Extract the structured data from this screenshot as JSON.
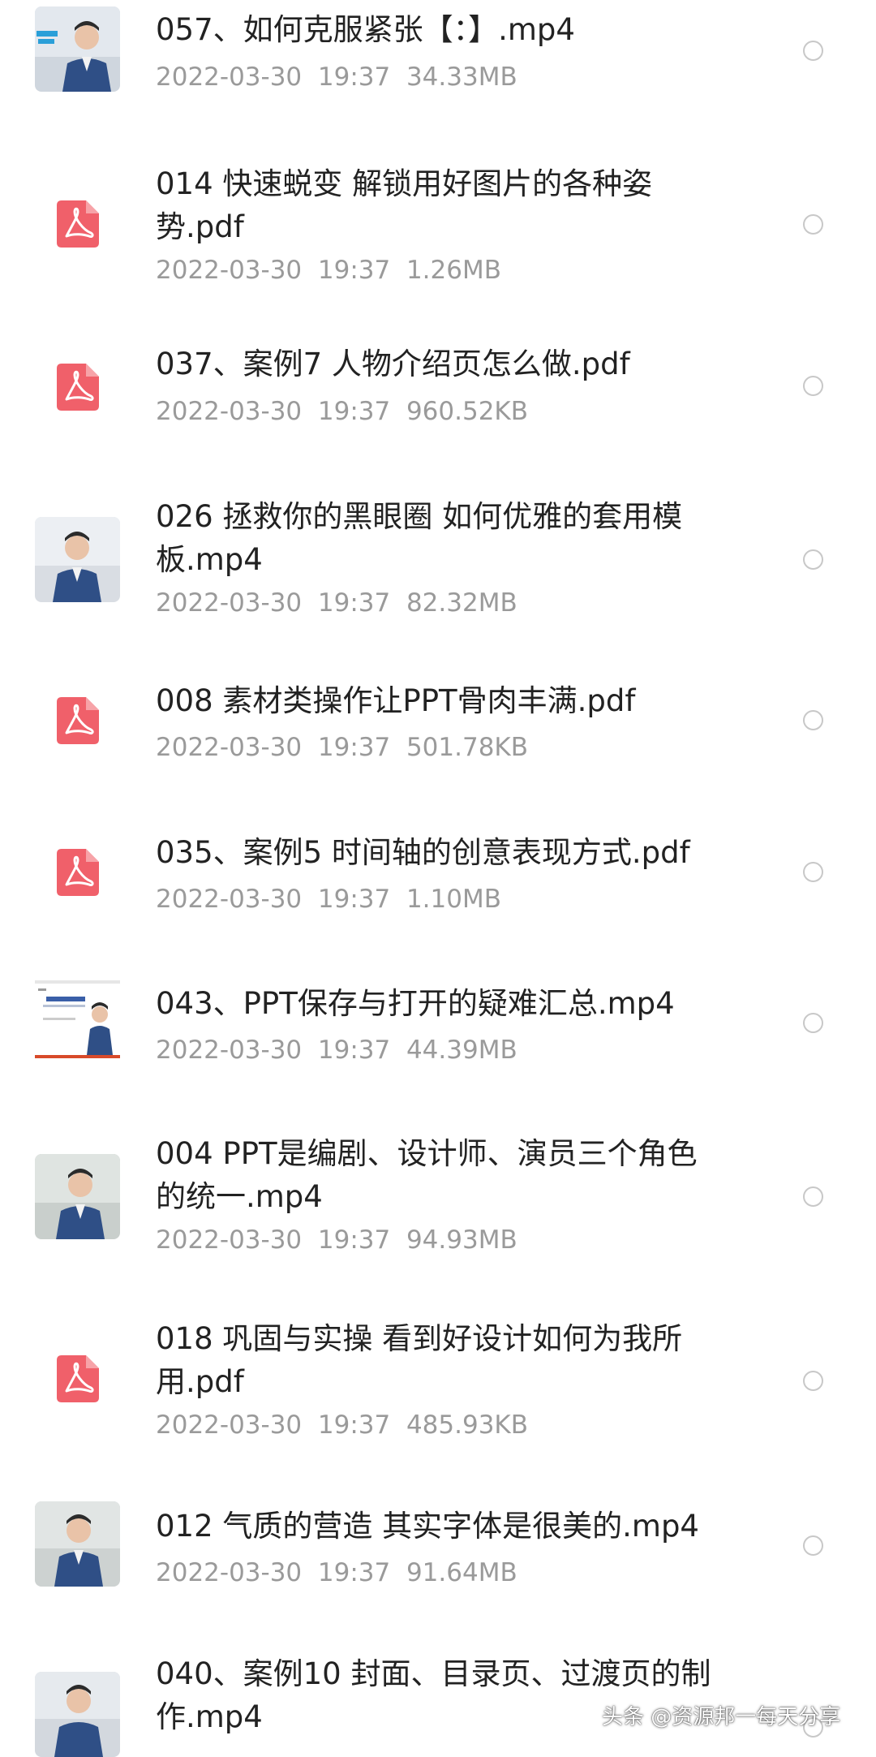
{
  "files": [
    {
      "name": "057、如何克服紧张【：】.mp4",
      "date": "2022-03-30",
      "time": "19:37",
      "size": "34.33MB",
      "type": "video",
      "thumbnail": "video-thumbnail-with-caption"
    },
    {
      "name": "014 快速蜕变 解锁用好图片的各种姿势.pdf",
      "date": "2022-03-30",
      "time": "19:37",
      "size": "1.26MB",
      "type": "pdf",
      "icon": "pdf-icon"
    },
    {
      "name": "037、案例7 人物介绍页怎么做.pdf",
      "date": "2022-03-30",
      "time": "19:37",
      "size": "960.52KB",
      "type": "pdf",
      "icon": "pdf-icon"
    },
    {
      "name": "026 拯救你的黑眼圈 如何优雅的套用模板.mp4",
      "date": "2022-03-30",
      "time": "19:37",
      "size": "82.32MB",
      "type": "video",
      "thumbnail": "video-thumbnail"
    },
    {
      "name": "008 素材类操作让PPT骨肉丰满.pdf",
      "date": "2022-03-30",
      "time": "19:37",
      "size": "501.78KB",
      "type": "pdf",
      "icon": "pdf-icon"
    },
    {
      "name": "035、案例5 时间轴的创意表现方式.pdf",
      "date": "2022-03-30",
      "time": "19:37",
      "size": "1.10MB",
      "type": "pdf",
      "icon": "pdf-icon"
    },
    {
      "name": "043、PPT保存与打开的疑难汇总.mp4",
      "date": "2022-03-30",
      "time": "19:37",
      "size": "44.39MB",
      "type": "video",
      "thumbnail": "video-thumbnail-slide"
    },
    {
      "name": "004 PPT是编剧、设计师、演员三个角色的统一.mp4",
      "date": "2022-03-30",
      "time": "19:37",
      "size": "94.93MB",
      "type": "video",
      "thumbnail": "video-thumbnail"
    },
    {
      "name": "018 巩固与实操 看到好设计如何为我所用.pdf",
      "date": "2022-03-30",
      "time": "19:37",
      "size": "485.93KB",
      "type": "pdf",
      "icon": "pdf-icon"
    },
    {
      "name": "012 气质的营造 其实字体是很美的.mp4",
      "date": "2022-03-30",
      "time": "19:37",
      "size": "91.64MB",
      "type": "video",
      "thumbnail": "video-thumbnail"
    },
    {
      "name": "040、案例10 封面、目录页、过渡页的制作.mp4",
      "type": "video",
      "thumbnail": "video-thumbnail"
    }
  ],
  "watermark": "头条 @资源邦一每天分享",
  "colors": {
    "pdf_icon": "#f0606a",
    "title_text": "#222222",
    "meta_text": "#9a9a9a",
    "radio_border": "#c8c8c8"
  }
}
